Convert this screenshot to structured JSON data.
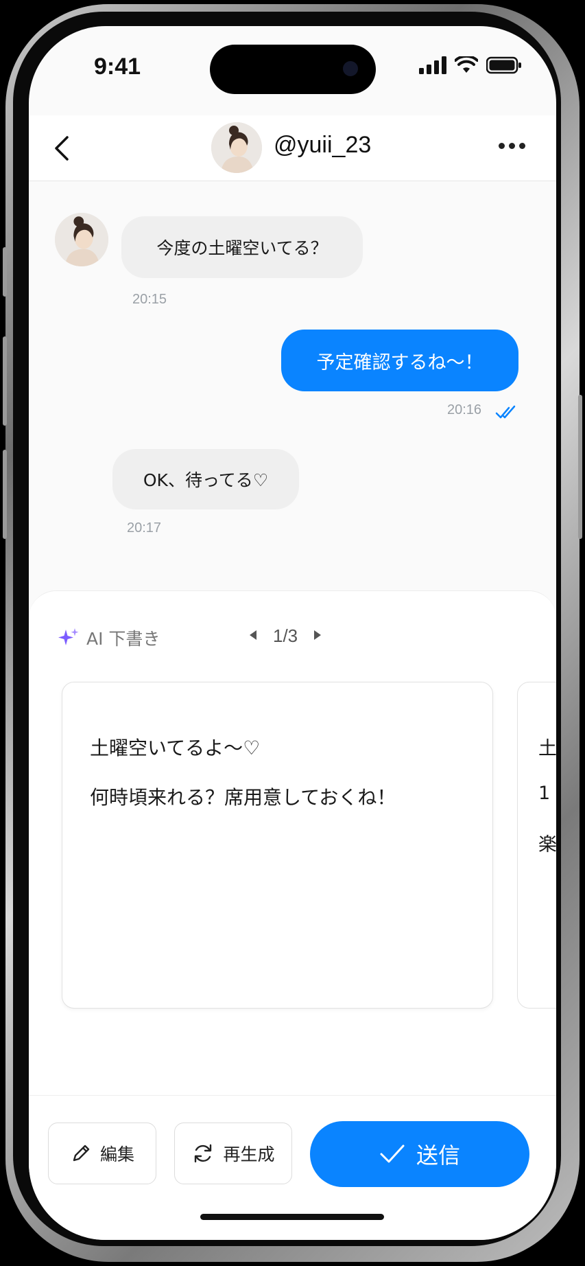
{
  "status_bar": {
    "time": "9:41"
  },
  "header": {
    "username": "@yuii_23"
  },
  "messages": [
    {
      "text": "今度の土曜空いてる？",
      "time": "20:15",
      "direction": "in"
    },
    {
      "text": "予定確認するね〜！",
      "time": "20:16",
      "direction": "out",
      "read": true
    },
    {
      "text": "OK、待ってる♡",
      "time": "20:17",
      "direction": "in"
    }
  ],
  "ai_draft": {
    "label": "AI 下書き",
    "page_indicator": "1/3",
    "draft_lines": [
      "土曜空いてるよ〜♡",
      "何時頃来れる？席用意しておくね！"
    ],
    "next_card_peek": [
      "土",
      "1",
      "楽"
    ]
  },
  "actions": {
    "edit_label": "編集",
    "regenerate_label": "再生成",
    "send_label": "送信"
  },
  "colors": {
    "accent": "#0a84ff",
    "sparkle": "#7b5cff"
  }
}
